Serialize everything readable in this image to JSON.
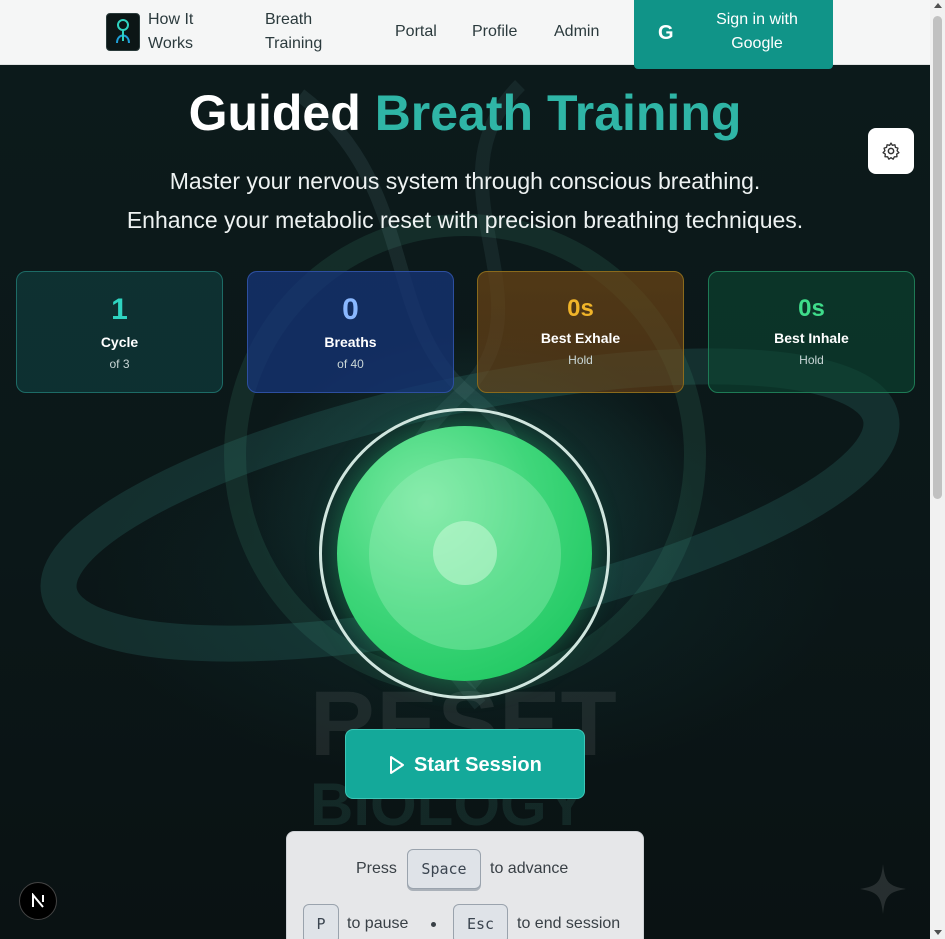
{
  "nav": {
    "items": [
      {
        "label": "How It Works"
      },
      {
        "label": "Breath Training"
      },
      {
        "label": "Portal"
      },
      {
        "label": "Profile"
      },
      {
        "label": "Admin"
      }
    ],
    "signin_label": "Sign in with Google"
  },
  "hero": {
    "title_plain": "Guided",
    "title_accent": "Breath Training",
    "subtitle_line1": "Master your nervous system through conscious breathing.",
    "subtitle_line2": "Enhance your metabolic reset with precision breathing techniques."
  },
  "stats": [
    {
      "value": "1",
      "label": "Cycle",
      "sub": "of 3",
      "color": "#2fd3c0"
    },
    {
      "value": "0",
      "label": "Breaths",
      "sub": "of 40",
      "color": "#6fa8ff"
    },
    {
      "value": "0s",
      "label": "Best Exhale",
      "sub": "Hold",
      "color": "#f0b429"
    },
    {
      "value": "0s",
      "label": "Best Inhale",
      "sub": "Hold",
      "color": "#3fdc8a"
    }
  ],
  "start_label": "Start Session",
  "shortcuts": {
    "press": "Press",
    "space_key": "Space",
    "advance": "to advance",
    "p_key": "P",
    "pause": "to pause",
    "esc_key": "Esc",
    "end": "to end session"
  },
  "background_words": {
    "top": "RESET",
    "bottom": "BIOLOGY"
  },
  "icons": {
    "logo": "reset-biology-logo",
    "google": "google-icon",
    "settings": "gear-icon",
    "play": "play-icon",
    "badge": "nextjs-badge",
    "sparkle": "sparkle-icon"
  },
  "colors": {
    "accent": "#109488",
    "orb": "#2ecc71"
  }
}
